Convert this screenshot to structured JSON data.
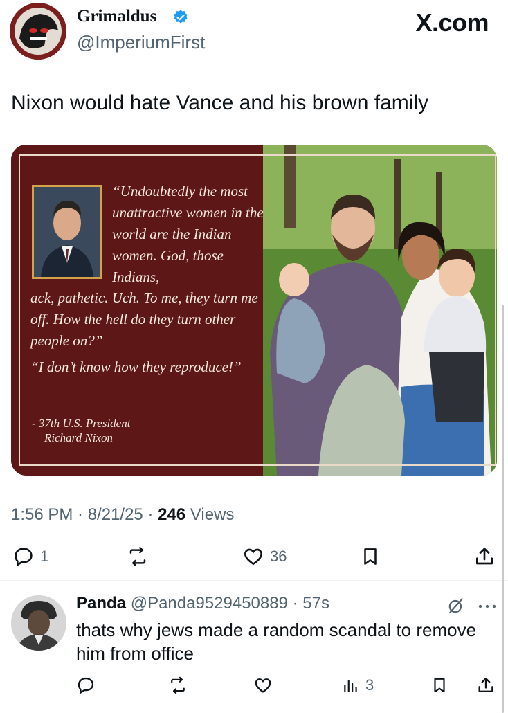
{
  "tweet": {
    "display_name": "Grimaldus",
    "handle": "@ImperiumFirst",
    "text": "Nixon would hate Vance and his brown family",
    "timestamp": "1:56 PM · 8/21/25 · ",
    "views_count": "246",
    "views_label": " Views",
    "reply_count": "1",
    "like_count": "36"
  },
  "brand": {
    "label": "X.com"
  },
  "media": {
    "quote_part1": "“Undoubtedly the most unattractive women in the world are the Indian women. God, those Indians,",
    "quote_part2": "ack, pathetic. Uch. To me, they turn me off. How the hell do they turn other people on?”",
    "quote_part3": "“I don’t know how they reproduce!”",
    "attrib_line1": "- 37th U.S. President",
    "attrib_line2": "Richard Nixon"
  },
  "reply": {
    "name": "Panda",
    "handle_time": " @Panda9529450889 · 57s",
    "text": "thats why jews made a random scandal to remove him from office",
    "views_count": "3"
  },
  "colors": {
    "accent": "#1d9bf0",
    "muted": "#536471",
    "panel": "#5e1717",
    "frame": "#d4a24a"
  },
  "icons": [
    "verified-badge-icon",
    "reply-icon",
    "retweet-icon",
    "like-icon",
    "bookmark-icon",
    "share-icon",
    "grok-icon",
    "more-icon",
    "views-icon"
  ]
}
